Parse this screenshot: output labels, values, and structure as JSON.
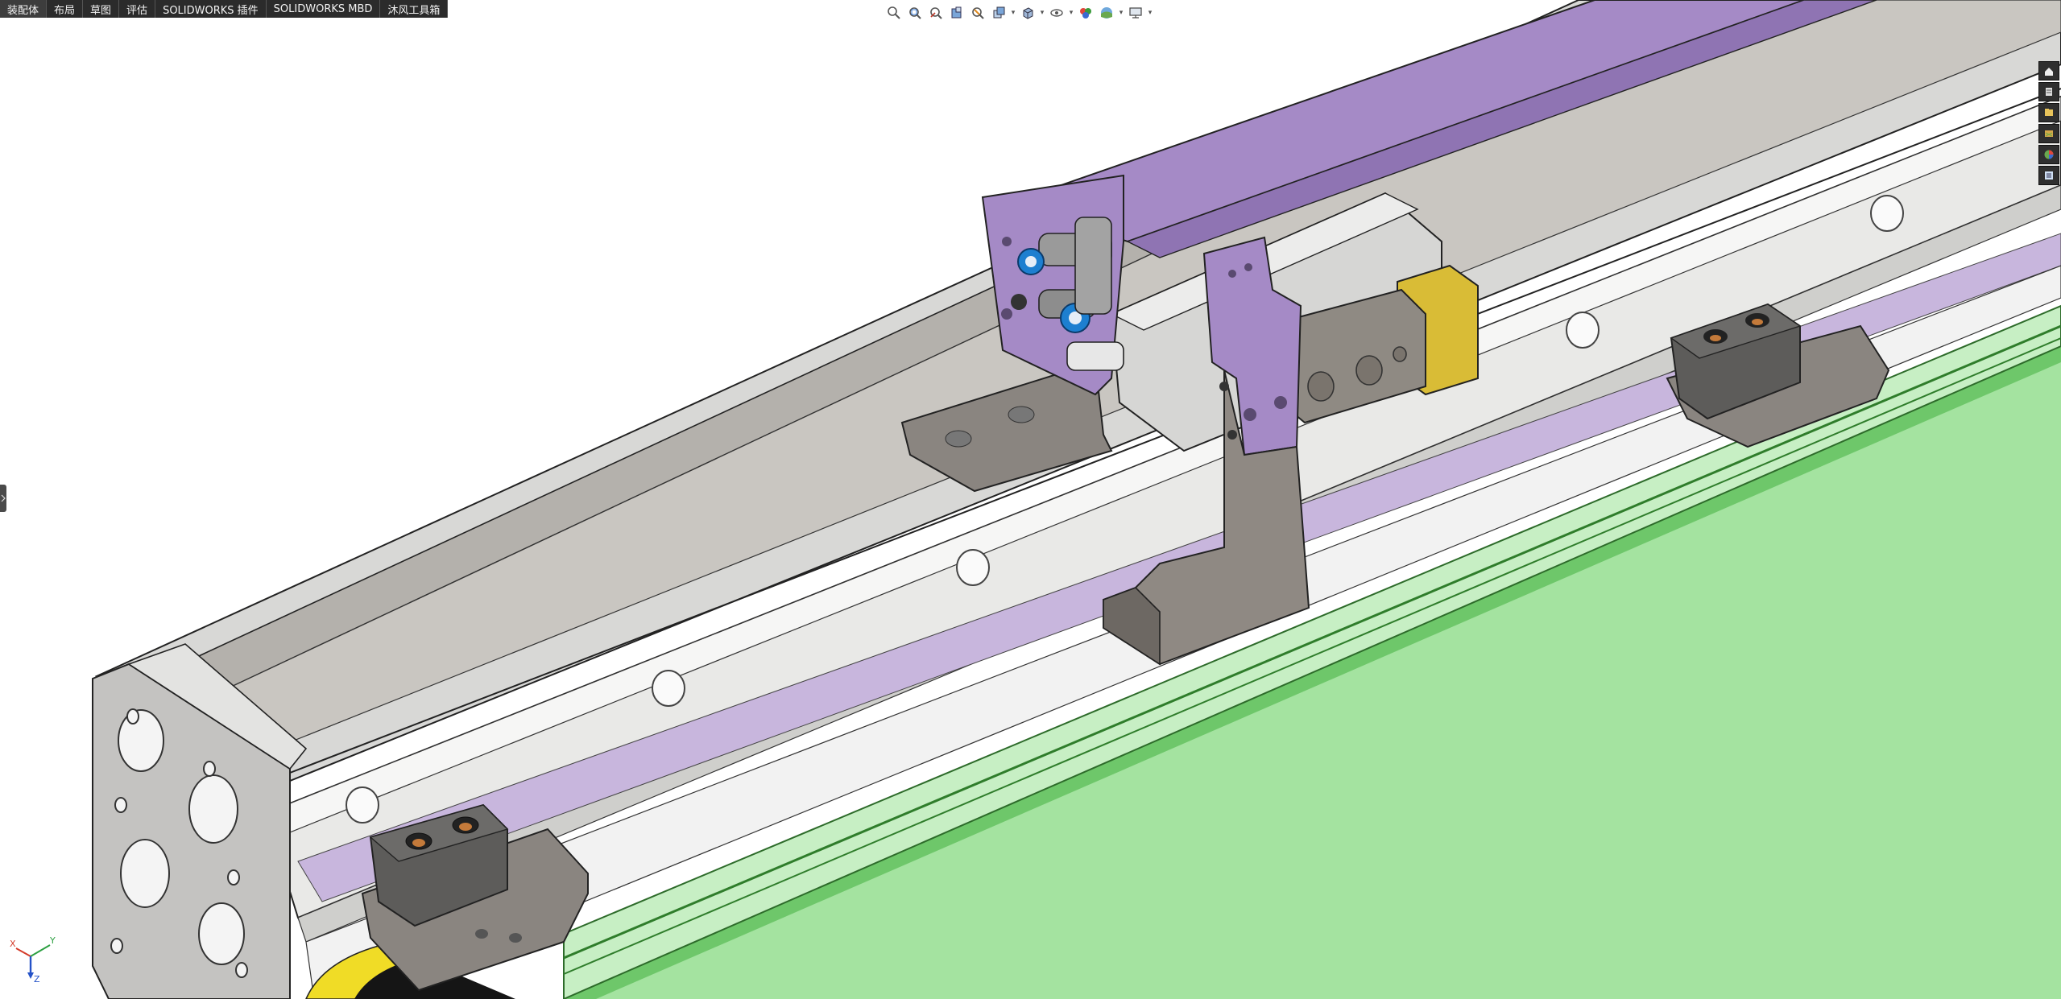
{
  "command_manager": {
    "tabs": [
      "装配体",
      "布局",
      "草图",
      "评估",
      "SOLIDWORKS 插件",
      "SOLIDWORKS MBD",
      "沐风工具箱"
    ],
    "active_tab": "装配体"
  },
  "heads_up_toolbar": {
    "icons": [
      "zoom-to-fit-icon",
      "zoom-to-area-icon",
      "previous-view-icon",
      "section-view-icon",
      "dynamic-annotation-icon",
      "view-orientation-icon",
      "display-style-icon",
      "hide-show-icon",
      "edit-appearance-icon",
      "apply-scene-icon",
      "view-settings-icon"
    ]
  },
  "task_pane": {
    "icons": [
      "home-icon",
      "resources-icon",
      "design-library-icon",
      "file-explorer-icon",
      "appearances-icon",
      "custom-properties-icon"
    ]
  },
  "reference_triad": {
    "x_label": "X",
    "y_label": "Y",
    "z_label": "Z",
    "colors": {
      "x": "#d43b2a",
      "y": "#2ea043",
      "z": "#2452c8"
    }
  },
  "model_colors": {
    "rail_silver": "#d9d9d9",
    "profile_gray": "#b3b0ab",
    "bracket_purple": "#a58ac6",
    "block_dark": "#5d5c5a",
    "plate_brown": "#8a8580",
    "accent_yellow": "#d9bc36",
    "fitting_blue": "#1d7fd0",
    "base_green": "#a4e3a0"
  }
}
